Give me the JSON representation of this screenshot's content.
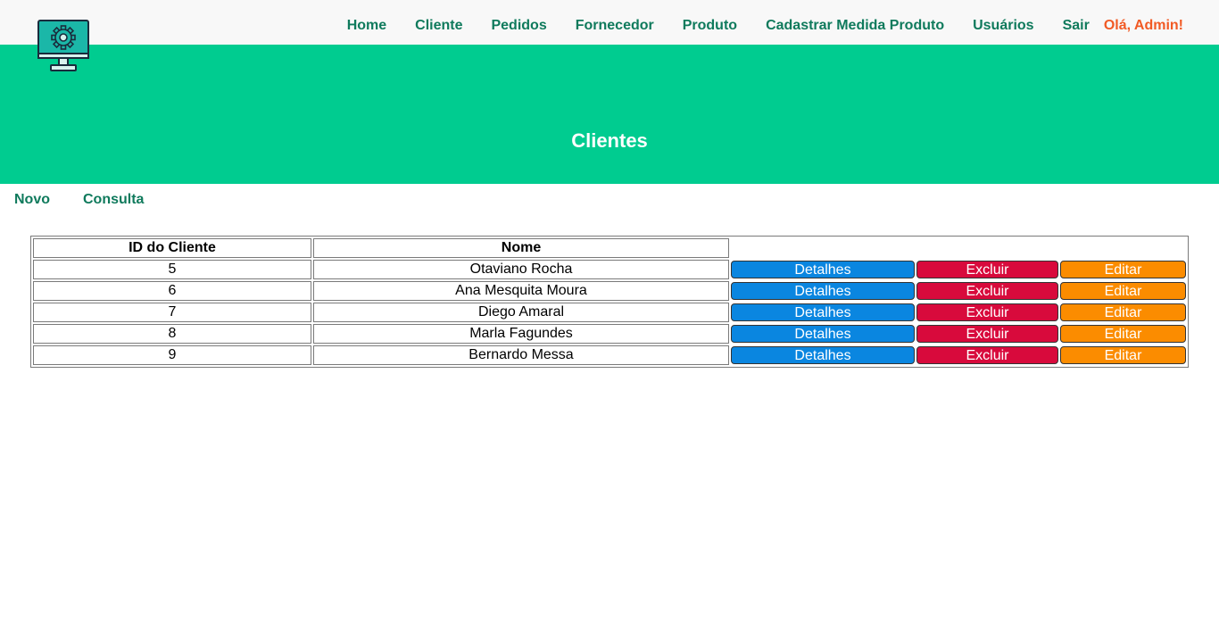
{
  "header": {
    "nav": [
      {
        "label": "Home"
      },
      {
        "label": "Cliente"
      },
      {
        "label": "Pedidos"
      },
      {
        "label": "Fornecedor"
      },
      {
        "label": "Produto"
      },
      {
        "label": "Cadastrar Medida Produto"
      },
      {
        "label": "Usuários"
      },
      {
        "label": "Sair"
      }
    ],
    "greeting": "Olá, Admin!"
  },
  "hero": {
    "title": "Clientes"
  },
  "subnav": {
    "new_label": "Novo",
    "query_label": "Consulta"
  },
  "table": {
    "columns": {
      "id": "ID do Cliente",
      "name": "Nome"
    },
    "rows": [
      {
        "id": "5",
        "name": "Otaviano Rocha"
      },
      {
        "id": "6",
        "name": "Ana Mesquita Moura"
      },
      {
        "id": "7",
        "name": "Diego Amaral"
      },
      {
        "id": "8",
        "name": "Marla Fagundes"
      },
      {
        "id": "9",
        "name": "Bernardo Messa"
      }
    ],
    "actions": {
      "details": "Detalhes",
      "delete": "Excluir",
      "edit": "Editar"
    }
  },
  "colors": {
    "topbar": "#f8f8f8",
    "hero": "#00cc90",
    "nav_text": "#0f7a5c",
    "greeting": "#f15a24",
    "details_button": "#0a86e0",
    "delete_button": "#d80a3c",
    "edit_button": "#fb8c00"
  }
}
